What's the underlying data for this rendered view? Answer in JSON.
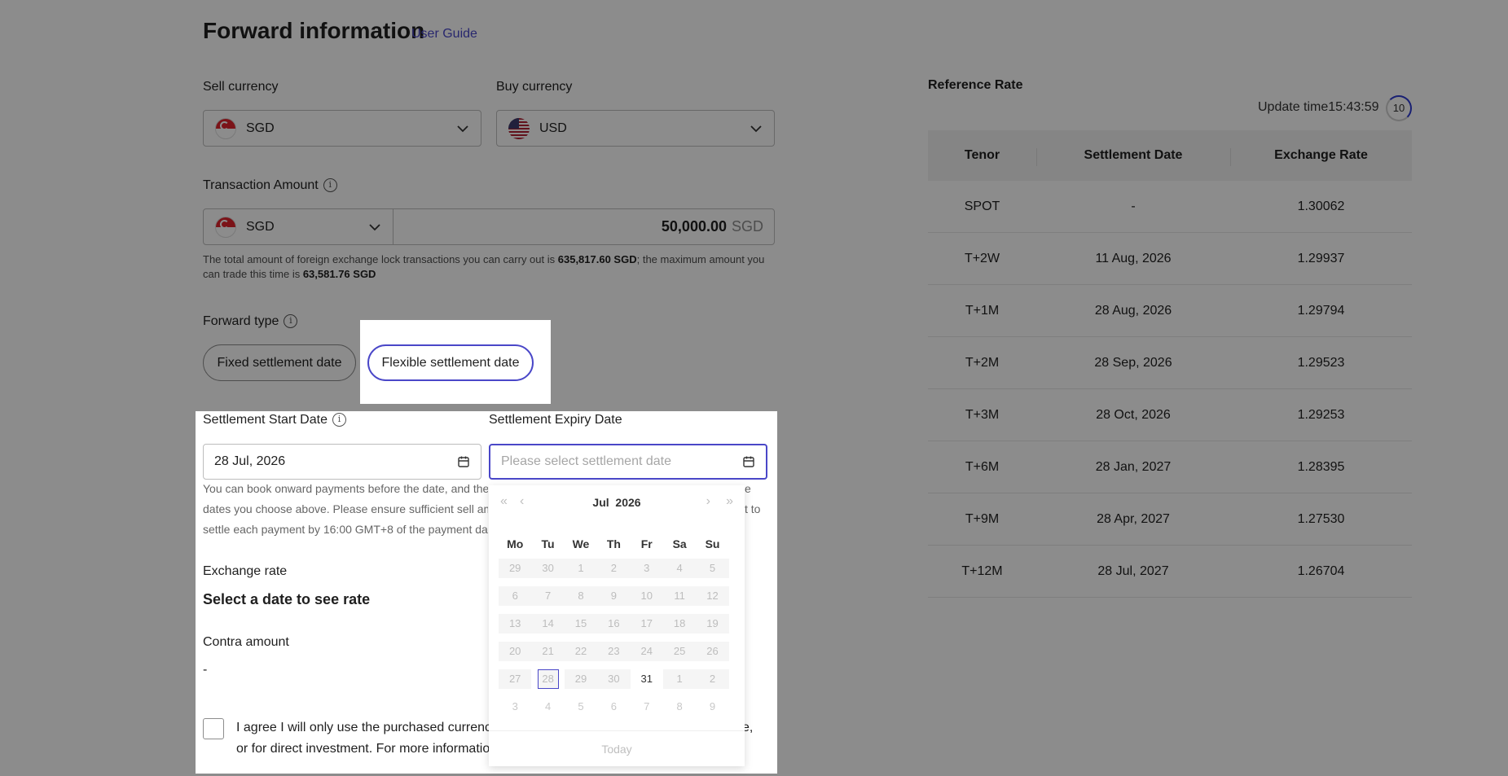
{
  "header": {
    "title": "Forward information",
    "guide_link": "User Guide"
  },
  "sell": {
    "label": "Sell currency",
    "value": "SGD"
  },
  "buy": {
    "label": "Buy currency",
    "value": "USD"
  },
  "amount": {
    "label": "Transaction Amount",
    "currency": "SGD",
    "value": "50,000.00",
    "unit": "SGD",
    "help_prefix": "The total amount of foreign exchange lock transactions you can carry out is ",
    "help_total": "635,817.60 SGD",
    "help_middle": "; the maximum amount you can trade this time is ",
    "help_max": "63,581.76 SGD"
  },
  "forward_type": {
    "label": "Forward type",
    "options": [
      "Fixed settlement date",
      "Flexible settlement date"
    ],
    "selected": "Flexible settlement date"
  },
  "start_date": {
    "label": "Settlement Start Date",
    "value": "28 Jul, 2026",
    "note_col1": [
      "You can book onward payments before the date, and the p",
      "dates you choose above. Please ensure sufficient sell amo",
      "settle each payment by 16:00 GMT+8 of the payment date"
    ],
    "note_col3": [
      "e",
      "t to",
      ""
    ]
  },
  "expiry_date": {
    "label": "Settlement Expiry Date",
    "placeholder": "Please select settlement date"
  },
  "calendar": {
    "month": "Jul",
    "year": "2026",
    "nav": {
      "super_prev": "«",
      "prev": "‹",
      "next": "›",
      "super_next": "»"
    },
    "weekdays": [
      "Mo",
      "Tu",
      "We",
      "Th",
      "Fr",
      "Sa",
      "Su"
    ],
    "weeks": [
      [
        "29",
        "30",
        "1",
        "2",
        "3",
        "4",
        "5"
      ],
      [
        "6",
        "7",
        "8",
        "9",
        "10",
        "11",
        "12"
      ],
      [
        "13",
        "14",
        "15",
        "16",
        "17",
        "18",
        "19"
      ],
      [
        "20",
        "21",
        "22",
        "23",
        "24",
        "25",
        "26"
      ],
      [
        "27",
        "28",
        "29",
        "30",
        "31",
        "1",
        "2"
      ],
      [
        "3",
        "4",
        "5",
        "6",
        "7",
        "8",
        "9"
      ]
    ],
    "selected_day": "28",
    "enabled_day": "31",
    "today": "Today"
  },
  "exchange_rate": {
    "label": "Exchange rate",
    "value": "Select a date to see rate"
  },
  "contra": {
    "label": "Contra amount",
    "value": "-"
  },
  "agreement": {
    "line1_left": "I agree I will only use the purchased currenc",
    "line1_right": "ce,",
    "line2_left": "or for direct investment. For more informatio"
  },
  "reference": {
    "title": "Reference Rate",
    "update_label": "Update time",
    "update_time": "15:43:59",
    "countdown": "10",
    "columns": [
      "Tenor",
      "Settlement Date",
      "Exchange Rate"
    ],
    "rows": [
      {
        "tenor": "SPOT",
        "date": "-",
        "rate": "1.30062"
      },
      {
        "tenor": "T+2W",
        "date": "11 Aug, 2026",
        "rate": "1.29937"
      },
      {
        "tenor": "T+1M",
        "date": "28 Aug, 2026",
        "rate": "1.29794"
      },
      {
        "tenor": "T+2M",
        "date": "28 Sep, 2026",
        "rate": "1.29523"
      },
      {
        "tenor": "T+3M",
        "date": "28 Oct, 2026",
        "rate": "1.29253"
      },
      {
        "tenor": "T+6M",
        "date": "28 Jan, 2027",
        "rate": "1.28395"
      },
      {
        "tenor": "T+9M",
        "date": "28 Apr, 2027",
        "rate": "1.27530"
      },
      {
        "tenor": "T+12M",
        "date": "28 Jul, 2027",
        "rate": "1.26704"
      }
    ]
  },
  "colors": {
    "accent": "#4a47c8",
    "overlay": "rgba(0,0,0,0.45)",
    "timer": "#2f3bd1"
  }
}
